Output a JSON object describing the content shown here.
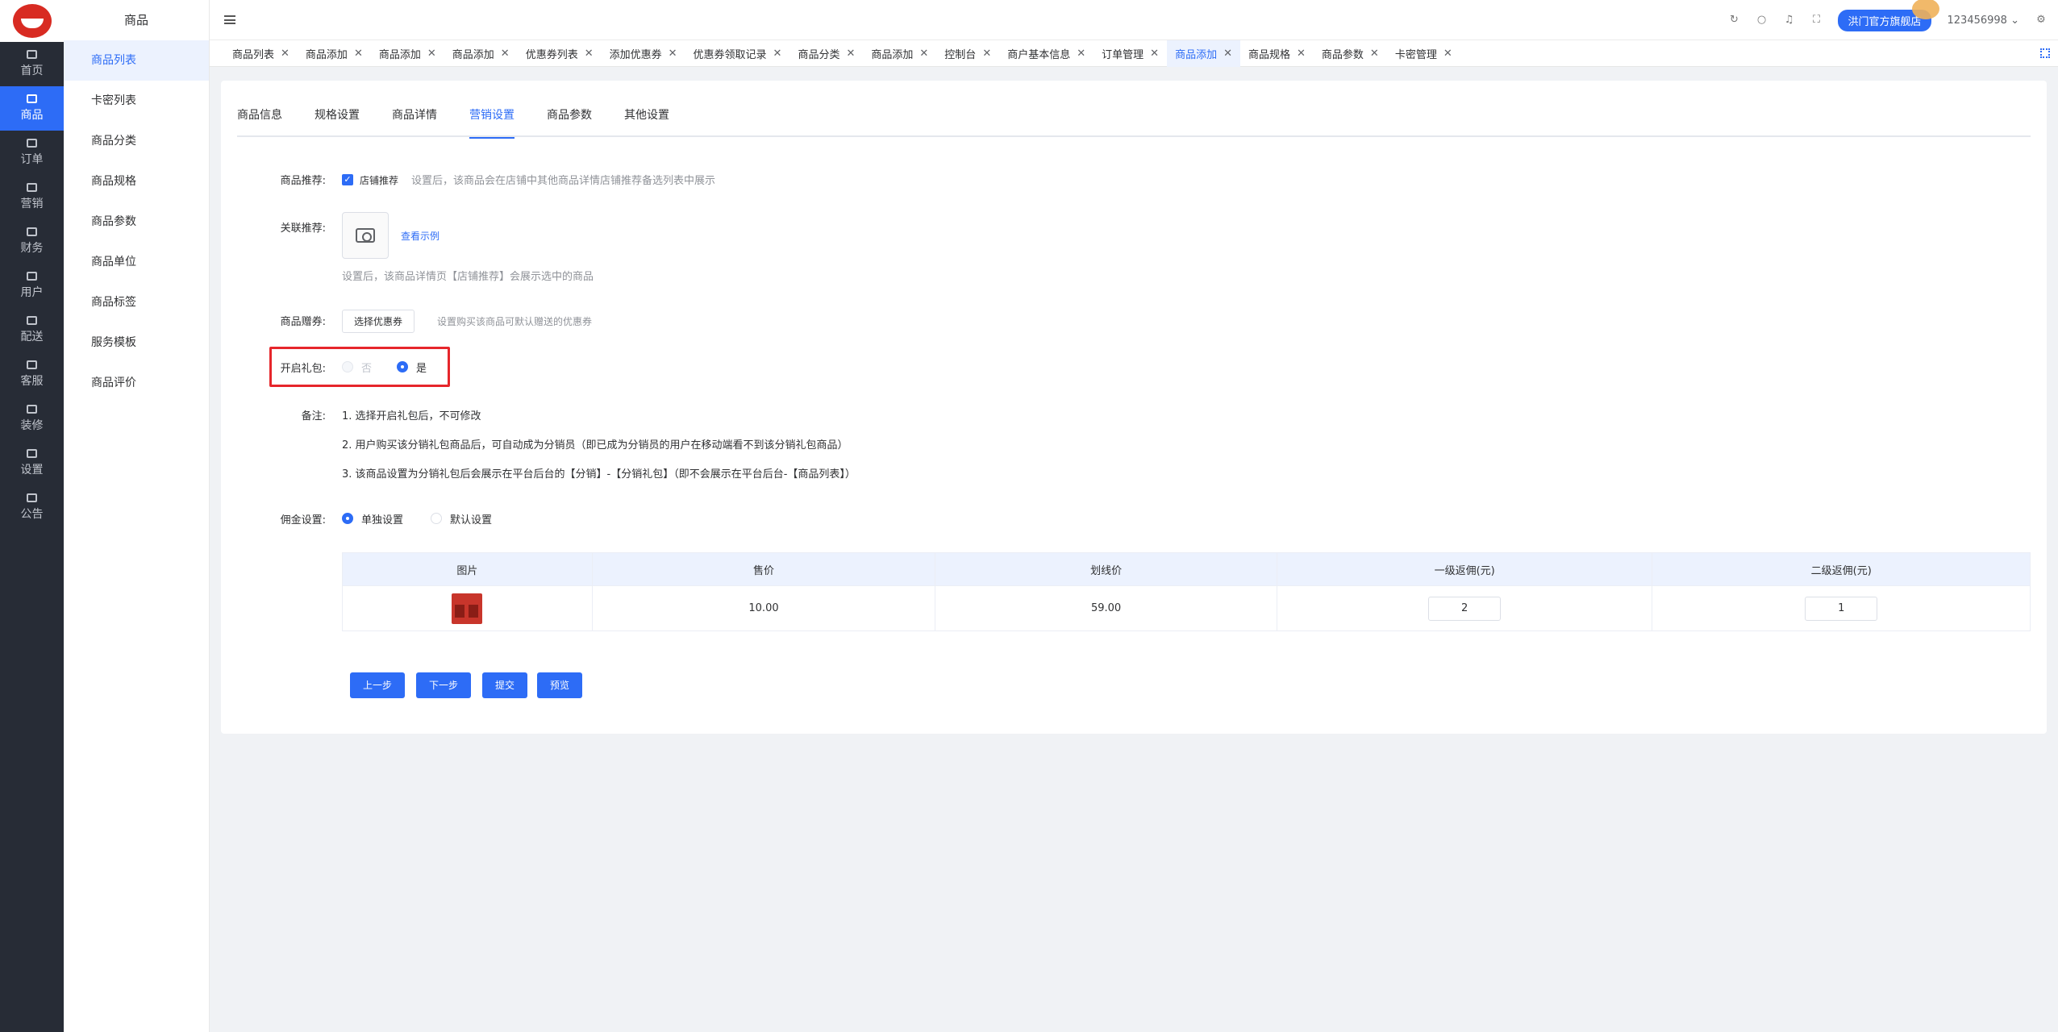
{
  "rail": {
    "items": [
      {
        "label": "首页",
        "icon": "home-icon",
        "active": false
      },
      {
        "label": "商品",
        "icon": "bag-icon",
        "active": true
      },
      {
        "label": "订单",
        "icon": "order-icon",
        "active": false
      },
      {
        "label": "营销",
        "icon": "bell-icon",
        "active": false
      },
      {
        "label": "财务",
        "icon": "pie-icon",
        "active": false
      },
      {
        "label": "用户",
        "icon": "user-icon",
        "active": false
      },
      {
        "label": "配送",
        "icon": "truck-icon",
        "active": false
      },
      {
        "label": "客服",
        "icon": "headset-icon",
        "active": false
      },
      {
        "label": "装修",
        "icon": "brush-icon",
        "active": false
      },
      {
        "label": "设置",
        "icon": "gear-icon",
        "active": false
      },
      {
        "label": "公告",
        "icon": "notice-icon",
        "active": false
      }
    ]
  },
  "submenu": {
    "title": "商品",
    "items": [
      "商品列表",
      "卡密列表",
      "商品分类",
      "商品规格",
      "商品参数",
      "商品单位",
      "商品标签",
      "服务模板",
      "商品评价"
    ]
  },
  "header": {
    "shop_name": "洪门官方旗舰店",
    "username": "123456998"
  },
  "tabs": [
    {
      "label": "商品列表"
    },
    {
      "label": "商品添加"
    },
    {
      "label": "商品添加"
    },
    {
      "label": "商品添加"
    },
    {
      "label": "优惠券列表"
    },
    {
      "label": "添加优惠券"
    },
    {
      "label": "优惠券领取记录"
    },
    {
      "label": "商品分类"
    },
    {
      "label": "商品添加"
    },
    {
      "label": "控制台"
    },
    {
      "label": "商户基本信息"
    },
    {
      "label": "订单管理"
    },
    {
      "label": "商品添加",
      "active": true
    },
    {
      "label": "商品规格"
    },
    {
      "label": "商品参数"
    },
    {
      "label": "卡密管理"
    }
  ],
  "content_tabs": [
    "商品信息",
    "规格设置",
    "商品详情",
    "营销设置",
    "商品参数",
    "其他设置"
  ],
  "form": {
    "recommend_label": "商品推荐:",
    "recommend_checkbox": "店铺推荐",
    "recommend_hint": "设置后，该商品会在店铺中其他商品详情店铺推荐备选列表中展示",
    "related_label": "关联推荐:",
    "related_link": "查看示例",
    "related_hint": "设置后，该商品详情页【店铺推荐】会展示选中的商品",
    "gift_label": "商品赠券:",
    "gift_button": "选择优惠券",
    "gift_hint": "设置购买该商品可默认赠送的优惠券",
    "package_label": "开启礼包:",
    "package_no": "否",
    "package_yes": "是",
    "note_label": "备注:",
    "notes": [
      "1. 选择开启礼包后，不可修改",
      "2. 用户购买该分销礼包商品后，可自动成为分销员（即已成为分销员的用户在移动端看不到该分销礼包商品）",
      "3. 该商品设置为分销礼包后会展示在平台后台的【分销】-【分销礼包】（即不会展示在平台后台-【商品列表】）"
    ],
    "commission_label": "佣金设置:",
    "commission_single": "单独设置",
    "commission_default": "默认设置"
  },
  "table": {
    "headers": [
      "图片",
      "售价",
      "划线价",
      "一级返佣(元)",
      "二级返佣(元)"
    ],
    "rows": [
      {
        "price": "10.00",
        "original_price": "59.00",
        "level1": "2",
        "level2": "1"
      }
    ]
  },
  "buttons": {
    "prev": "上一步",
    "next": "下一步",
    "submit": "提交",
    "preview": "预览"
  }
}
